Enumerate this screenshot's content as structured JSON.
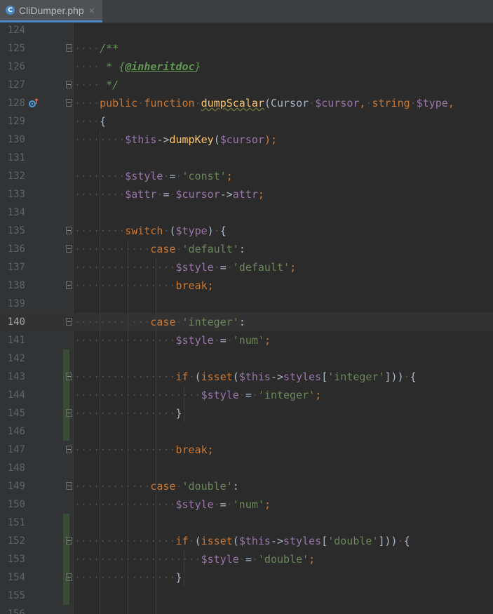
{
  "tab": {
    "icon": "php-class-icon",
    "icon_letter": "C",
    "title": "CliDumper.php",
    "close": "×"
  },
  "colors": {
    "keyword": "#cc7832",
    "variable": "#9876aa",
    "string": "#6a8759",
    "function": "#ffc66d",
    "doc": "#629755",
    "text": "#a9b7c6",
    "line_number": "#606366",
    "background": "#2b2b2b"
  },
  "lines": [
    {
      "n": "124",
      "indent": 0,
      "tokens": []
    },
    {
      "n": "125",
      "indent": 1,
      "fold": true,
      "tokens": [
        {
          "t": "/**",
          "c": "doc"
        }
      ]
    },
    {
      "n": "126",
      "indent": 1,
      "tokens": [
        {
          "t": " * ",
          "c": "doc"
        },
        {
          "t": "{",
          "c": "doc"
        },
        {
          "t": "@inheritdoc",
          "c": "tag"
        },
        {
          "t": "}",
          "c": "doc"
        }
      ]
    },
    {
      "n": "127",
      "indent": 1,
      "fold": true,
      "tokens": [
        {
          "t": " */",
          "c": "doc"
        }
      ]
    },
    {
      "n": "128",
      "indent": 1,
      "fold": true,
      "impl": true,
      "tokens": [
        {
          "t": "public",
          "c": "kw"
        },
        {
          "t": " ",
          "c": "ws"
        },
        {
          "t": "function",
          "c": "kw"
        },
        {
          "t": " ",
          "c": "ws"
        },
        {
          "t": "dumpScalar",
          "c": "fnu"
        },
        {
          "t": "(Cursor",
          "c": "plain"
        },
        {
          "t": " ",
          "c": "ws"
        },
        {
          "t": "$cursor",
          "c": "var"
        },
        {
          "t": ",",
          "c": "kw"
        },
        {
          "t": " ",
          "c": "ws"
        },
        {
          "t": "string",
          "c": "kw"
        },
        {
          "t": " ",
          "c": "ws"
        },
        {
          "t": "$type",
          "c": "var"
        },
        {
          "t": ",",
          "c": "kw"
        }
      ]
    },
    {
      "n": "129",
      "indent": 1,
      "tokens": [
        {
          "t": "{",
          "c": "plain"
        }
      ]
    },
    {
      "n": "130",
      "indent": 2,
      "tokens": [
        {
          "t": "$this",
          "c": "var"
        },
        {
          "t": "->",
          "c": "plain"
        },
        {
          "t": "dumpKey",
          "c": "fn"
        },
        {
          "t": "(",
          "c": "plain"
        },
        {
          "t": "$cursor",
          "c": "var"
        },
        {
          "t": ");",
          "c": "kw"
        }
      ]
    },
    {
      "n": "131",
      "indent": 0,
      "tokens": []
    },
    {
      "n": "132",
      "indent": 2,
      "tokens": [
        {
          "t": "$style",
          "c": "var"
        },
        {
          "t": " ",
          "c": "ws"
        },
        {
          "t": "=",
          "c": "plain"
        },
        {
          "t": " ",
          "c": "ws"
        },
        {
          "t": "'const'",
          "c": "str"
        },
        {
          "t": ";",
          "c": "kw"
        }
      ]
    },
    {
      "n": "133",
      "indent": 2,
      "tokens": [
        {
          "t": "$attr",
          "c": "var"
        },
        {
          "t": " ",
          "c": "ws"
        },
        {
          "t": "=",
          "c": "plain"
        },
        {
          "t": " ",
          "c": "ws"
        },
        {
          "t": "$cursor",
          "c": "var"
        },
        {
          "t": "->",
          "c": "plain"
        },
        {
          "t": "attr",
          "c": "var"
        },
        {
          "t": ";",
          "c": "kw"
        }
      ]
    },
    {
      "n": "134",
      "indent": 0,
      "tokens": []
    },
    {
      "n": "135",
      "indent": 2,
      "fold": true,
      "tokens": [
        {
          "t": "switch",
          "c": "kw"
        },
        {
          "t": " ",
          "c": "ws"
        },
        {
          "t": "(",
          "c": "plain"
        },
        {
          "t": "$type",
          "c": "var"
        },
        {
          "t": ")",
          "c": "plain"
        },
        {
          "t": " ",
          "c": "ws"
        },
        {
          "t": "{",
          "c": "plain"
        }
      ]
    },
    {
      "n": "136",
      "indent": 3,
      "fold": true,
      "tokens": [
        {
          "t": "case",
          "c": "kw"
        },
        {
          "t": " ",
          "c": "ws"
        },
        {
          "t": "'default'",
          "c": "str"
        },
        {
          "t": ":",
          "c": "plain"
        }
      ]
    },
    {
      "n": "137",
      "indent": 4,
      "tokens": [
        {
          "t": "$style",
          "c": "var"
        },
        {
          "t": " ",
          "c": "ws"
        },
        {
          "t": "=",
          "c": "plain"
        },
        {
          "t": " ",
          "c": "ws"
        },
        {
          "t": "'default'",
          "c": "str"
        },
        {
          "t": ";",
          "c": "kw"
        }
      ]
    },
    {
      "n": "138",
      "indent": 4,
      "fold": true,
      "tokens": [
        {
          "t": "break",
          "c": "kw"
        },
        {
          "t": ";",
          "c": "kw"
        }
      ]
    },
    {
      "n": "139",
      "indent": 0,
      "tokens": []
    },
    {
      "n": "140",
      "indent": 3,
      "fold": true,
      "current": true,
      "tokens": [
        {
          "t": "case",
          "c": "kw"
        },
        {
          "t": " ",
          "c": "ws"
        },
        {
          "t": "'integer'",
          "c": "str"
        },
        {
          "t": ":",
          "c": "plain"
        }
      ]
    },
    {
      "n": "141",
      "indent": 4,
      "tokens": [
        {
          "t": "$style",
          "c": "var"
        },
        {
          "t": " ",
          "c": "ws"
        },
        {
          "t": "=",
          "c": "plain"
        },
        {
          "t": " ",
          "c": "ws"
        },
        {
          "t": "'num'",
          "c": "str"
        },
        {
          "t": ";",
          "c": "kw"
        }
      ]
    },
    {
      "n": "142",
      "indent": 0,
      "change": true,
      "tokens": []
    },
    {
      "n": "143",
      "indent": 4,
      "fold": true,
      "change": true,
      "tokens": [
        {
          "t": "if",
          "c": "kw"
        },
        {
          "t": " ",
          "c": "ws"
        },
        {
          "t": "(",
          "c": "plain"
        },
        {
          "t": "isset",
          "c": "kw"
        },
        {
          "t": "(",
          "c": "plain"
        },
        {
          "t": "$this",
          "c": "var"
        },
        {
          "t": "->",
          "c": "plain"
        },
        {
          "t": "styles",
          "c": "var"
        },
        {
          "t": "[",
          "c": "plain"
        },
        {
          "t": "'integer'",
          "c": "str"
        },
        {
          "t": "]))",
          "c": "plain"
        },
        {
          "t": " ",
          "c": "ws"
        },
        {
          "t": "{",
          "c": "plain"
        }
      ]
    },
    {
      "n": "144",
      "indent": 5,
      "change": true,
      "tokens": [
        {
          "t": "$style",
          "c": "var"
        },
        {
          "t": " ",
          "c": "ws"
        },
        {
          "t": "=",
          "c": "plain"
        },
        {
          "t": " ",
          "c": "ws"
        },
        {
          "t": "'integer'",
          "c": "str"
        },
        {
          "t": ";",
          "c": "kw"
        }
      ]
    },
    {
      "n": "145",
      "indent": 4,
      "fold": true,
      "change": true,
      "tokens": [
        {
          "t": "}",
          "c": "plain"
        }
      ]
    },
    {
      "n": "146",
      "indent": 0,
      "change": true,
      "tokens": []
    },
    {
      "n": "147",
      "indent": 4,
      "fold": true,
      "tokens": [
        {
          "t": "break",
          "c": "kw"
        },
        {
          "t": ";",
          "c": "kw"
        }
      ]
    },
    {
      "n": "148",
      "indent": 0,
      "tokens": []
    },
    {
      "n": "149",
      "indent": 3,
      "fold": true,
      "tokens": [
        {
          "t": "case",
          "c": "kw"
        },
        {
          "t": " ",
          "c": "ws"
        },
        {
          "t": "'double'",
          "c": "str"
        },
        {
          "t": ":",
          "c": "plain"
        }
      ]
    },
    {
      "n": "150",
      "indent": 4,
      "tokens": [
        {
          "t": "$style",
          "c": "var"
        },
        {
          "t": " ",
          "c": "ws"
        },
        {
          "t": "=",
          "c": "plain"
        },
        {
          "t": " ",
          "c": "ws"
        },
        {
          "t": "'num'",
          "c": "str"
        },
        {
          "t": ";",
          "c": "kw"
        }
      ]
    },
    {
      "n": "151",
      "indent": 0,
      "change": true,
      "tokens": []
    },
    {
      "n": "152",
      "indent": 4,
      "fold": true,
      "change": true,
      "tokens": [
        {
          "t": "if",
          "c": "kw"
        },
        {
          "t": " ",
          "c": "ws"
        },
        {
          "t": "(",
          "c": "plain"
        },
        {
          "t": "isset",
          "c": "kw"
        },
        {
          "t": "(",
          "c": "plain"
        },
        {
          "t": "$this",
          "c": "var"
        },
        {
          "t": "->",
          "c": "plain"
        },
        {
          "t": "styles",
          "c": "var"
        },
        {
          "t": "[",
          "c": "plain"
        },
        {
          "t": "'double'",
          "c": "str"
        },
        {
          "t": "]))",
          "c": "plain"
        },
        {
          "t": " ",
          "c": "ws"
        },
        {
          "t": "{",
          "c": "plain"
        }
      ]
    },
    {
      "n": "153",
      "indent": 5,
      "change": true,
      "tokens": [
        {
          "t": "$style",
          "c": "var"
        },
        {
          "t": " ",
          "c": "ws"
        },
        {
          "t": "=",
          "c": "plain"
        },
        {
          "t": " ",
          "c": "ws"
        },
        {
          "t": "'double'",
          "c": "str"
        },
        {
          "t": ";",
          "c": "kw"
        }
      ]
    },
    {
      "n": "154",
      "indent": 4,
      "fold": true,
      "change": true,
      "tokens": [
        {
          "t": "}",
          "c": "plain"
        }
      ]
    },
    {
      "n": "155",
      "indent": 0,
      "change": true,
      "tokens": []
    },
    {
      "n": "156",
      "indent": 0,
      "tokens": []
    }
  ]
}
